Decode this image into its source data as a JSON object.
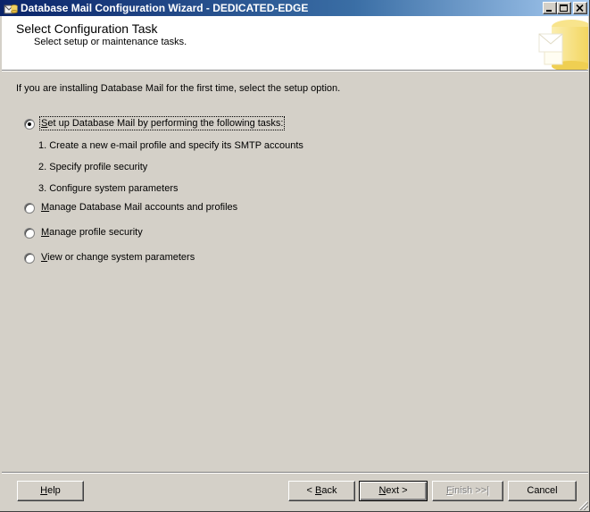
{
  "window": {
    "title": "Database Mail Configuration Wizard - DEDICATED-EDGE"
  },
  "header": {
    "title": "Select Configuration Task",
    "subtitle": "Select setup or maintenance tasks."
  },
  "intro": "If you are installing Database Mail for the first time, select the setup option.",
  "options": [
    {
      "pre": "",
      "key": "S",
      "rest": "et up Database Mail by performing the following tasks:",
      "selected": true
    },
    {
      "pre": "",
      "key": "M",
      "rest": "anage Database Mail accounts and profiles",
      "selected": false
    },
    {
      "pre": "",
      "key": "M",
      "rest": "anage profile security",
      "selected": false
    },
    {
      "pre": "",
      "key": "V",
      "rest": "iew or change system parameters",
      "selected": false
    }
  ],
  "steps": [
    "1. Create a new e-mail profile and specify its SMTP accounts",
    "2. Specify profile security",
    "3. Configure system parameters"
  ],
  "buttons": {
    "help": {
      "key": "H",
      "rest": "elp"
    },
    "back": {
      "pre": "< ",
      "key": "B",
      "rest": "ack"
    },
    "next": {
      "key": "N",
      "rest": "ext >"
    },
    "finish": {
      "key": "F",
      "rest": "inish >>|",
      "enabled": false
    },
    "cancel": "Cancel"
  }
}
